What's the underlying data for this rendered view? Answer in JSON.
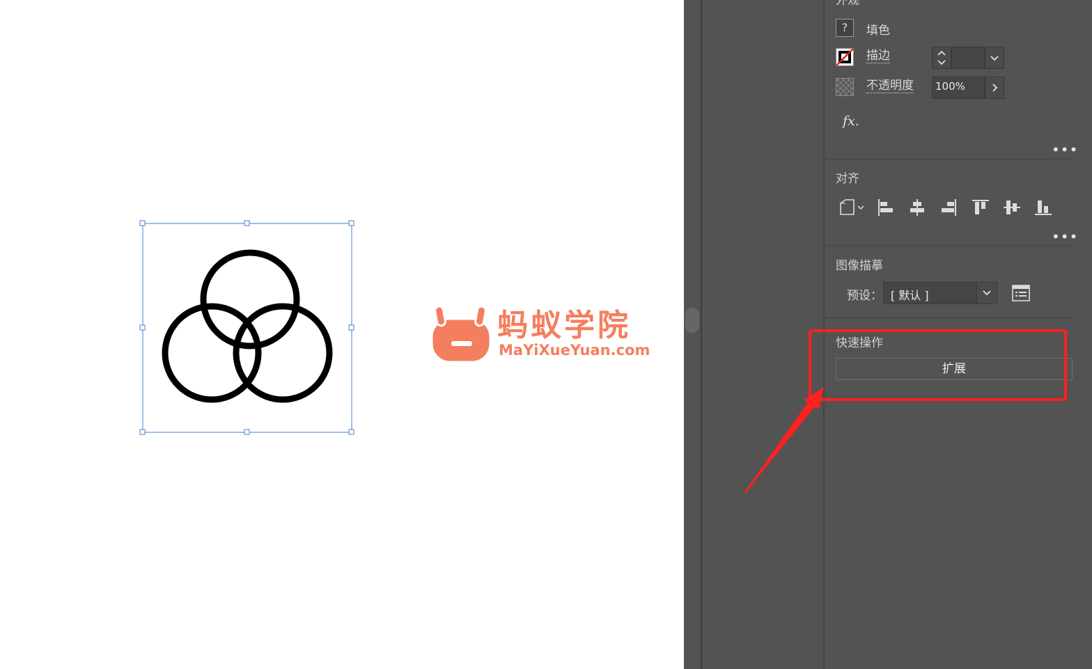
{
  "canvas": {
    "watermark": {
      "title": "蚂蚁学院",
      "url": "MaYiXueYuan.com"
    }
  },
  "panel": {
    "appearance": {
      "title": "外观",
      "fill": {
        "icon": "question-mark-icon",
        "glyph": "?",
        "label": "填色"
      },
      "stroke": {
        "label": "描边",
        "value": ""
      },
      "opacity": {
        "label": "不透明度",
        "value": "100%"
      },
      "fx_label": "fx.",
      "more": "•••"
    },
    "align": {
      "title": "对齐",
      "more": "•••",
      "icons": [
        "align-to-icon",
        "horizontal-align-left-icon",
        "horizontal-align-center-icon",
        "horizontal-align-right-icon",
        "vertical-align-top-icon",
        "vertical-align-center-icon",
        "vertical-align-bottom-icon"
      ]
    },
    "image_trace": {
      "title": "图像描摹",
      "preset_label": "预设：",
      "preset_value": "[ 默认 ]"
    },
    "quick_actions": {
      "title": "快速操作",
      "expand_label": "扩展"
    }
  },
  "colors": {
    "panel_bg": "#535353",
    "highlight": "#ff2020",
    "selection": "#4a7bd4",
    "watermark": "#f47f5f"
  }
}
